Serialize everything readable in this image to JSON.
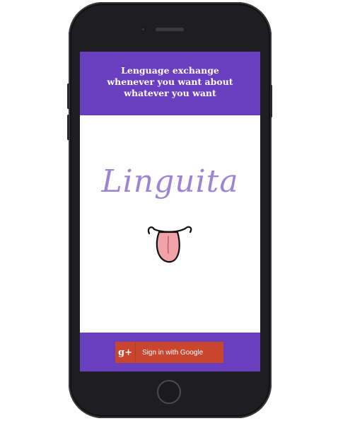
{
  "header": {
    "tagline_line1": "Lenguage exchange",
    "tagline_line2": "whenever you want about",
    "tagline_line3": "whatever you want"
  },
  "logo": {
    "text": "Linguita",
    "mascot_icon": "tongue-face-icon"
  },
  "signin": {
    "label": "Sign in with Google",
    "icon": "google-plus-icon",
    "icon_glyph": "g+"
  },
  "colors": {
    "brand": "#6a3fbf",
    "google": "#c9462e",
    "logo": "#9b86d6"
  }
}
